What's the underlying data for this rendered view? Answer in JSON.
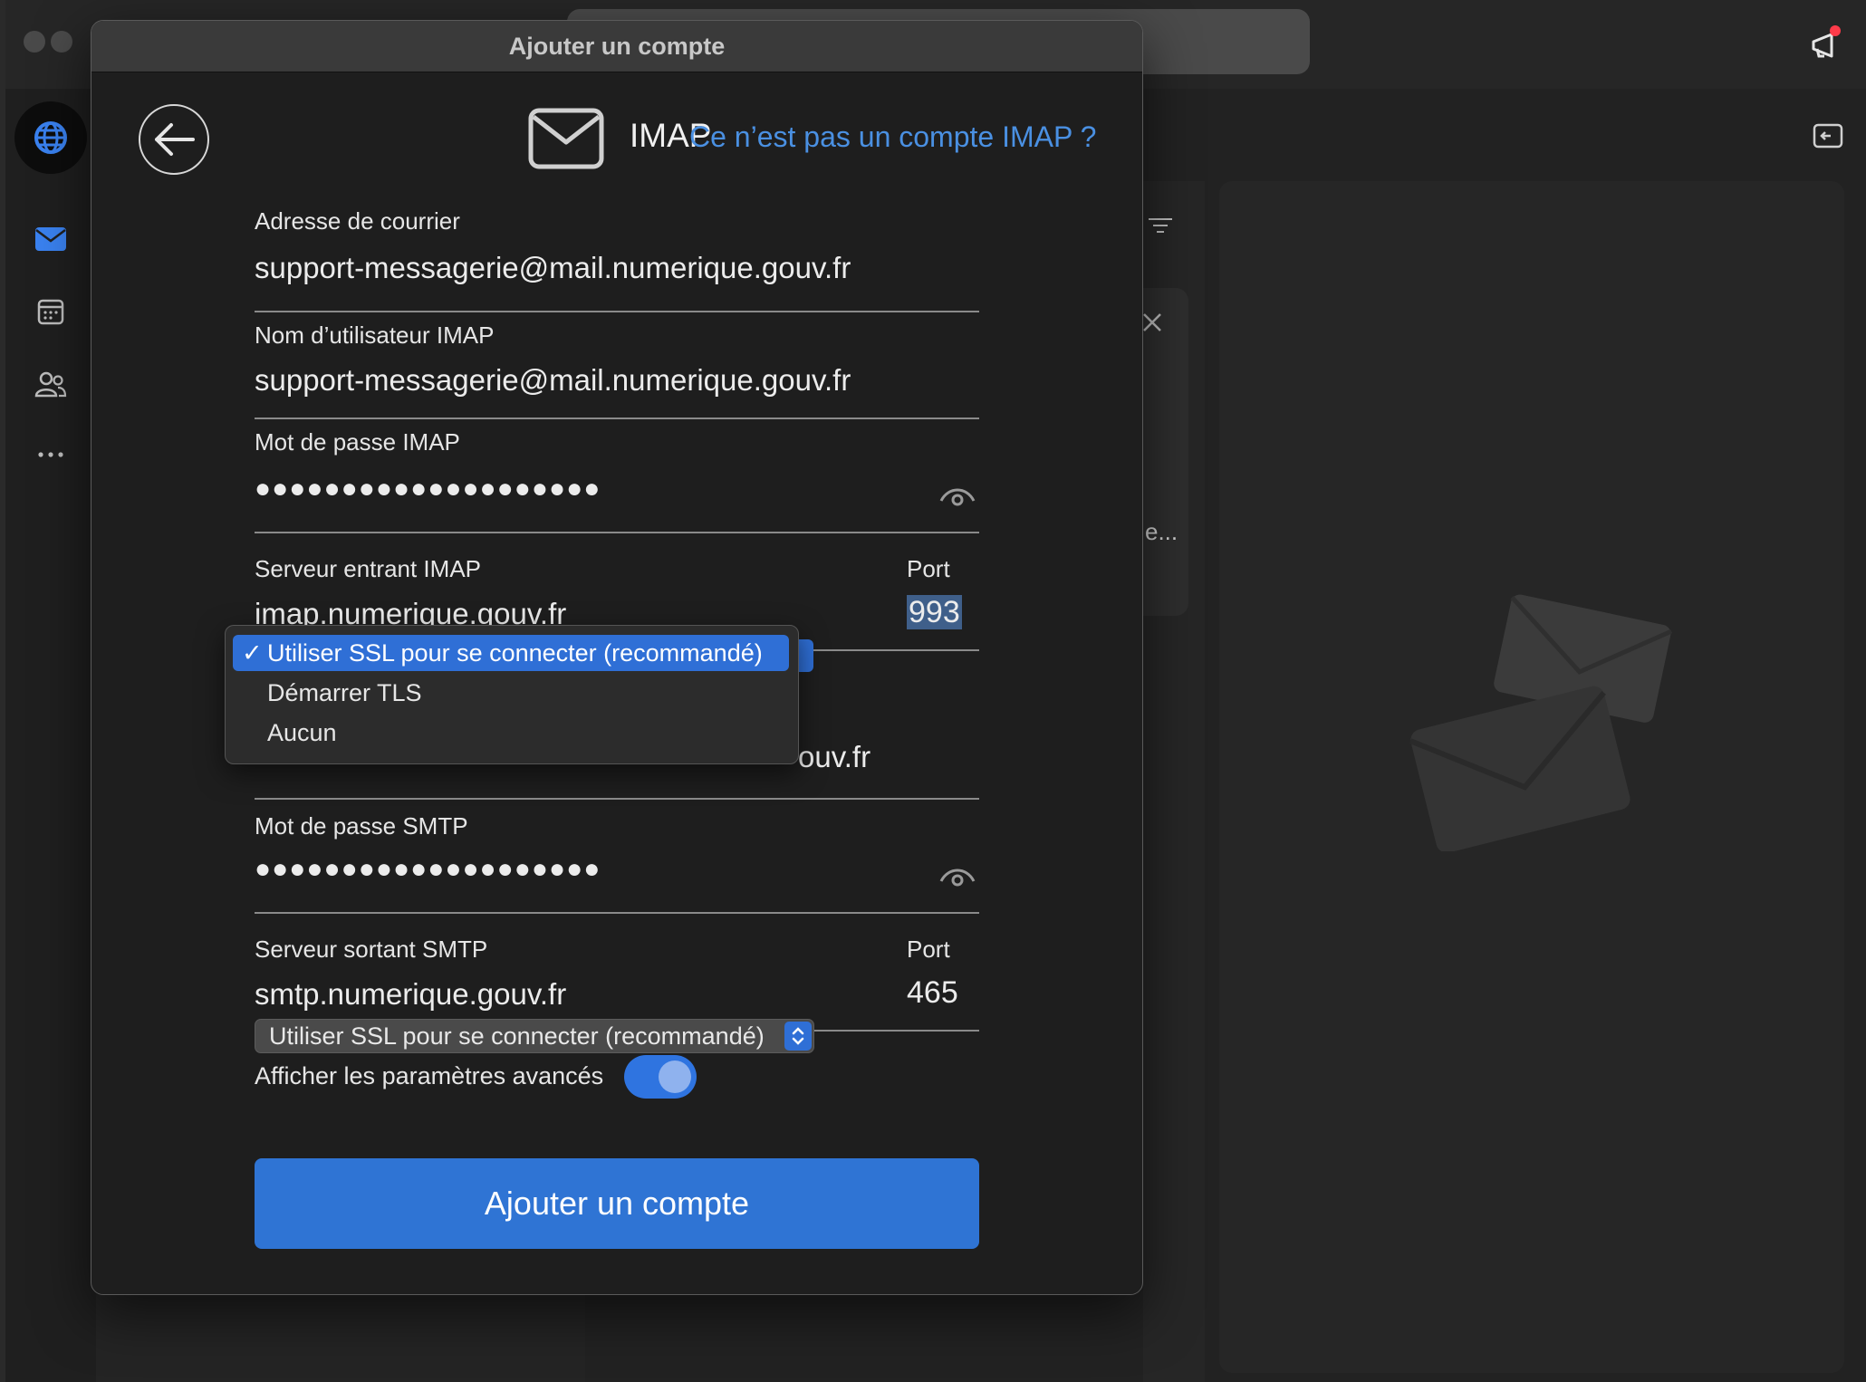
{
  "dialog": {
    "title": "Ajouter un compte",
    "account_type": "IMAP",
    "not_imap_link": "Ce n’est pas un compte IMAP ?",
    "email": {
      "label": "Adresse de courrier",
      "value": "support-messagerie@mail.numerique.gouv.fr"
    },
    "imap_user": {
      "label": "Nom d’utilisateur IMAP",
      "value": "support-messagerie@mail.numerique.gouv.fr"
    },
    "imap_password": {
      "label": "Mot de passe IMAP",
      "masked": "●●●●●●●●●●●●●●●●●●●●"
    },
    "imap_server": {
      "label": "Serveur entrant IMAP",
      "value": "imap.numerique.gouv.fr",
      "port_label": "Port",
      "port_value": "993"
    },
    "smtp_user_partial": "ouv.fr",
    "smtp_password": {
      "label": "Mot de passe SMTP",
      "masked": "●●●●●●●●●●●●●●●●●●●●"
    },
    "smtp_server": {
      "label": "Serveur sortant SMTP",
      "value": "smtp.numerique.gouv.fr",
      "port_label": "Port",
      "port_value": "465"
    },
    "smtp_security": "Utiliser SSL pour se connecter (recommandé)",
    "advanced_toggle": {
      "label": "Afficher les paramètres avancés",
      "on": true
    },
    "submit_label": "Ajouter un compte"
  },
  "security_menu": {
    "options": [
      "Utiliser SSL pour se connecter (recommandé)",
      "Démarrer TLS",
      "Aucun"
    ],
    "selected": 0,
    "check": "✓"
  },
  "background": {
    "list_preview_text": "e..."
  },
  "colors": {
    "accent": "#2f74d4",
    "link": "#4a90e2",
    "badge": "#ff3b4a"
  }
}
